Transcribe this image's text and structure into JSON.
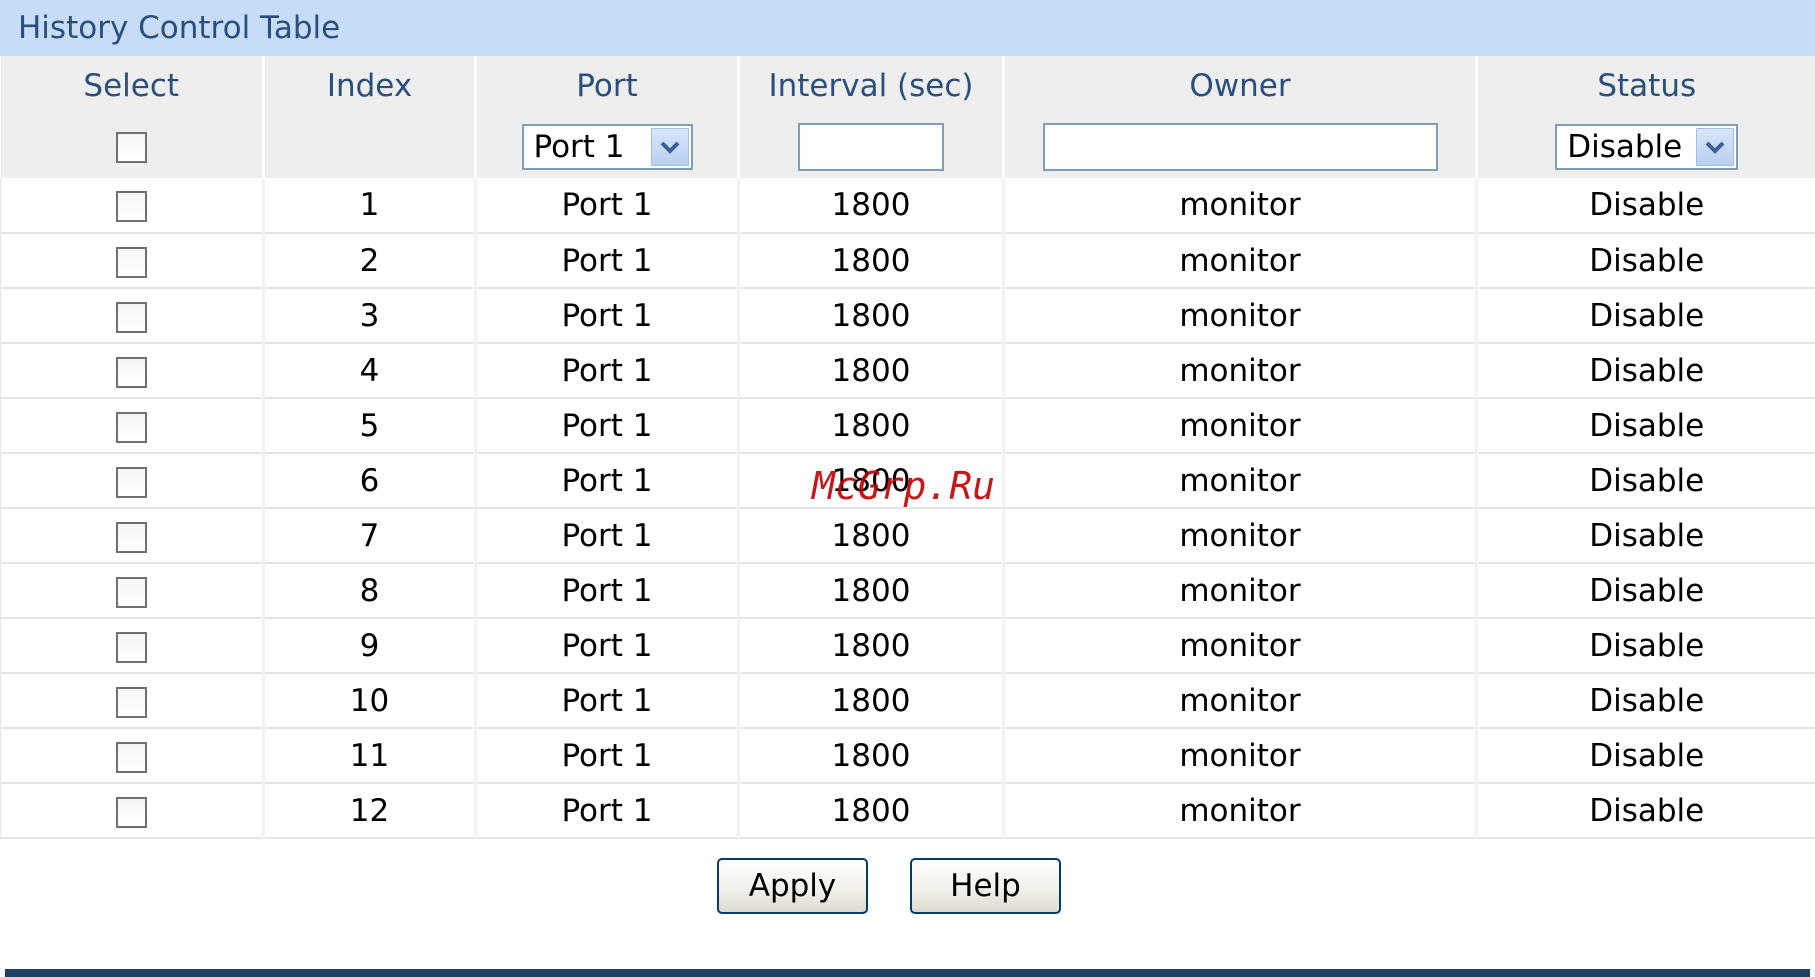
{
  "panel": {
    "title": "History Control Table"
  },
  "table": {
    "columns": [
      "Select",
      "Index",
      "Port",
      "Interval (sec)",
      "Owner",
      "Status"
    ],
    "edit_row": {
      "port_value": "Port 1",
      "interval_value": "",
      "owner_value": "",
      "status_value": "Disable"
    },
    "rows": [
      {
        "index": "1",
        "port": "Port 1",
        "interval": "1800",
        "owner": "monitor",
        "status": "Disable"
      },
      {
        "index": "2",
        "port": "Port 1",
        "interval": "1800",
        "owner": "monitor",
        "status": "Disable"
      },
      {
        "index": "3",
        "port": "Port 1",
        "interval": "1800",
        "owner": "monitor",
        "status": "Disable"
      },
      {
        "index": "4",
        "port": "Port 1",
        "interval": "1800",
        "owner": "monitor",
        "status": "Disable"
      },
      {
        "index": "5",
        "port": "Port 1",
        "interval": "1800",
        "owner": "monitor",
        "status": "Disable"
      },
      {
        "index": "6",
        "port": "Port 1",
        "interval": "1800",
        "owner": "monitor",
        "status": "Disable"
      },
      {
        "index": "7",
        "port": "Port 1",
        "interval": "1800",
        "owner": "monitor",
        "status": "Disable"
      },
      {
        "index": "8",
        "port": "Port 1",
        "interval": "1800",
        "owner": "monitor",
        "status": "Disable"
      },
      {
        "index": "9",
        "port": "Port 1",
        "interval": "1800",
        "owner": "monitor",
        "status": "Disable"
      },
      {
        "index": "10",
        "port": "Port 1",
        "interval": "1800",
        "owner": "monitor",
        "status": "Disable"
      },
      {
        "index": "11",
        "port": "Port 1",
        "interval": "1800",
        "owner": "monitor",
        "status": "Disable"
      },
      {
        "index": "12",
        "port": "Port 1",
        "interval": "1800",
        "owner": "monitor",
        "status": "Disable"
      }
    ]
  },
  "buttons": {
    "apply_label": "Apply",
    "help_label": "Help"
  },
  "watermark": "McGrp.Ru",
  "icons": {
    "dropdown": "chevron-down-icon",
    "checkbox": "checkbox-icon"
  },
  "colors": {
    "title_bar": "#c6dcf7",
    "header_text": "#2b4f7d",
    "bottom_rule": "#1f3f66"
  }
}
